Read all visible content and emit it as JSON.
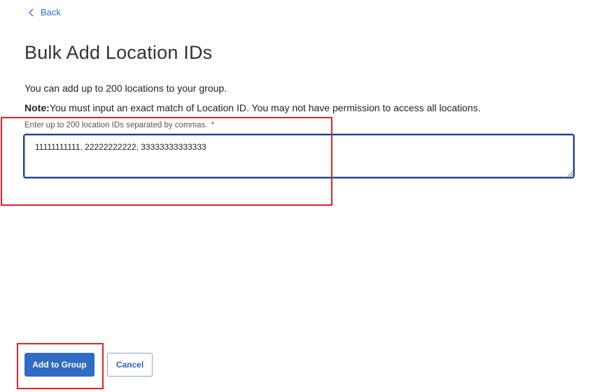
{
  "nav": {
    "back_label": "Back",
    "back_icon": "chevron-left-icon"
  },
  "page": {
    "title": "Bulk Add Location IDs",
    "intro": "You can add up to 200 locations to your group.",
    "note_label": "Note:",
    "note_text": "You must input an exact match of Location ID. You may not have permission to access all locations."
  },
  "form": {
    "field_label": "Enter up to 200 location IDs separated by commas.",
    "required_marker": "*",
    "field_value": "11111111111, 22222222222, 33333333333333"
  },
  "actions": {
    "primary_label": "Add to Group",
    "cancel_label": "Cancel"
  },
  "colors": {
    "accent": "#2f6cc4",
    "link": "#2f6fcf",
    "required": "#d9262a",
    "highlight": "#e0232d",
    "field_border": "#1f3f8a"
  }
}
